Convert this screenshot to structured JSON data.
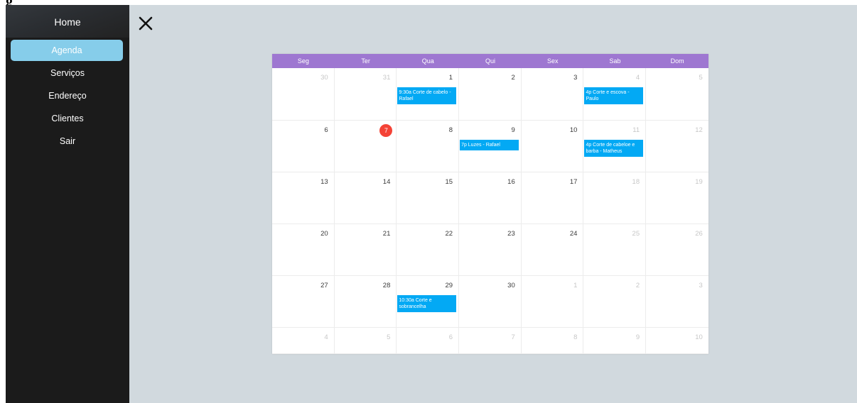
{
  "top_label": "g",
  "sidebar": {
    "home_label": "Home",
    "items": [
      {
        "label": "Agenda",
        "active": true
      },
      {
        "label": "Serviços",
        "active": false
      },
      {
        "label": "Endereço",
        "active": false
      },
      {
        "label": "Clientes",
        "active": false
      },
      {
        "label": "Sair",
        "active": false
      }
    ]
  },
  "close_icon": "close-icon",
  "calendar": {
    "weekdays": [
      "Seg",
      "Ter",
      "Qua",
      "Qui",
      "Sex",
      "Sab",
      "Dom"
    ],
    "weeks": [
      [
        {
          "day": "30",
          "other": true
        },
        {
          "day": "31",
          "other": true
        },
        {
          "day": "1",
          "event": "9:30a Corte de cabelo - Rafael"
        },
        {
          "day": "2"
        },
        {
          "day": "3"
        },
        {
          "day": "4",
          "other": true,
          "event": "4p Corte e escova - Paulo"
        },
        {
          "day": "5",
          "other": true
        }
      ],
      [
        {
          "day": "6"
        },
        {
          "day": "7",
          "today": true
        },
        {
          "day": "8"
        },
        {
          "day": "9",
          "event": "7p Luzes - Rafael"
        },
        {
          "day": "10"
        },
        {
          "day": "11",
          "other": true,
          "event": "4p Corte de cabeloe e barba - Matheus"
        },
        {
          "day": "12",
          "other": true
        }
      ],
      [
        {
          "day": "13"
        },
        {
          "day": "14"
        },
        {
          "day": "15"
        },
        {
          "day": "16"
        },
        {
          "day": "17"
        },
        {
          "day": "18",
          "other": true
        },
        {
          "day": "19",
          "other": true
        }
      ],
      [
        {
          "day": "20"
        },
        {
          "day": "21"
        },
        {
          "day": "22"
        },
        {
          "day": "23"
        },
        {
          "day": "24"
        },
        {
          "day": "25",
          "other": true
        },
        {
          "day": "26",
          "other": true
        }
      ],
      [
        {
          "day": "27"
        },
        {
          "day": "28"
        },
        {
          "day": "29",
          "event": "10:30a Corte e sobrancelha"
        },
        {
          "day": "30"
        },
        {
          "day": "1",
          "other": true
        },
        {
          "day": "2",
          "other": true
        },
        {
          "day": "3",
          "other": true
        }
      ],
      [
        {
          "day": "4",
          "other": true
        },
        {
          "day": "5",
          "other": true
        },
        {
          "day": "6",
          "other": true
        },
        {
          "day": "7",
          "other": true
        },
        {
          "day": "8",
          "other": true
        },
        {
          "day": "9",
          "other": true
        },
        {
          "day": "10",
          "other": true
        }
      ]
    ]
  },
  "colors": {
    "header": "#9e77d1",
    "event": "#03a9f4",
    "today": "#f44336",
    "active_nav": "#86cdea"
  }
}
